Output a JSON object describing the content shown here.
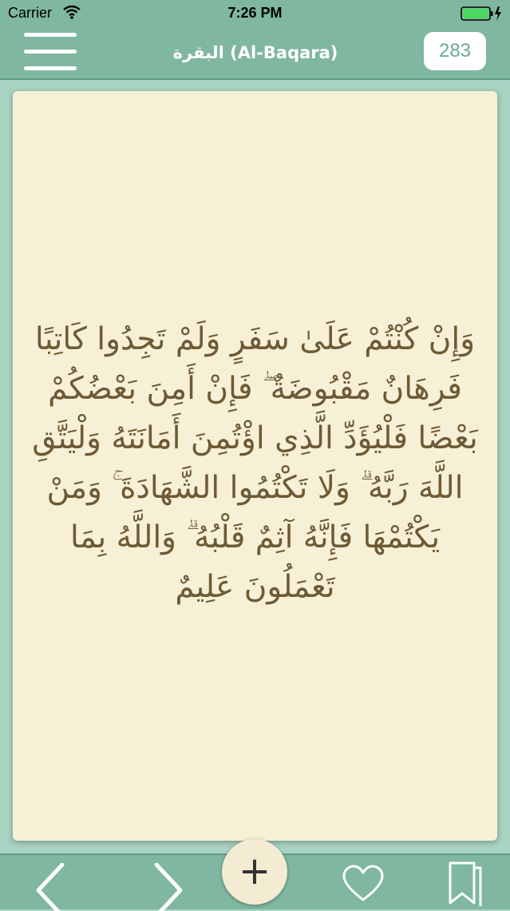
{
  "status_bar": {
    "carrier": "Carrier",
    "time": "7:26 PM",
    "wifi_icon": "wifi-icon",
    "battery_icon": "battery-charging-icon",
    "battery_color": "#4cd964"
  },
  "nav": {
    "menu_icon": "hamburger-menu-icon",
    "title": "البقرة (Al-Baqara)",
    "page_number": "283"
  },
  "verse": {
    "text": "وَإِنْ كُنْتُمْ عَلَىٰ سَفَرٍ وَلَمْ تَجِدُوا كَاتِبًا\nفَرِهَانٌ مَقْبُوضَةٌ ۖ فَإِنْ أَمِنَ بَعْضُكُمْ\nبَعْضًا فَلْيُؤَدِّ الَّذِي اؤْتُمِنَ أَمَانَتَهُ وَلْيَتَّقِ\nاللَّهَ رَبَّهُ ۗ وَلَا تَكْتُمُوا الشَّهَادَةَ ۚ وَمَنْ\nيَكْتُمْهَا فَإِنَّهُ آثِمٌ قَلْبُهُ ۗ وَاللَّهُ بِمَا\nتَعْمَلُونَ عَلِيمٌ"
  },
  "bottom_bar": {
    "prev_icon": "chevron-left-icon",
    "next_icon": "chevron-right-icon",
    "add_label": "+",
    "heart_icon": "heart-outline-icon",
    "bookmark_icon": "bookmark-icon"
  },
  "colors": {
    "bar_background": "#7fb7a0",
    "page_background": "#a9d3c2",
    "card_background": "#f6f0d7",
    "verse_text": "#6e5a34",
    "badge_text": "#6aab93"
  }
}
